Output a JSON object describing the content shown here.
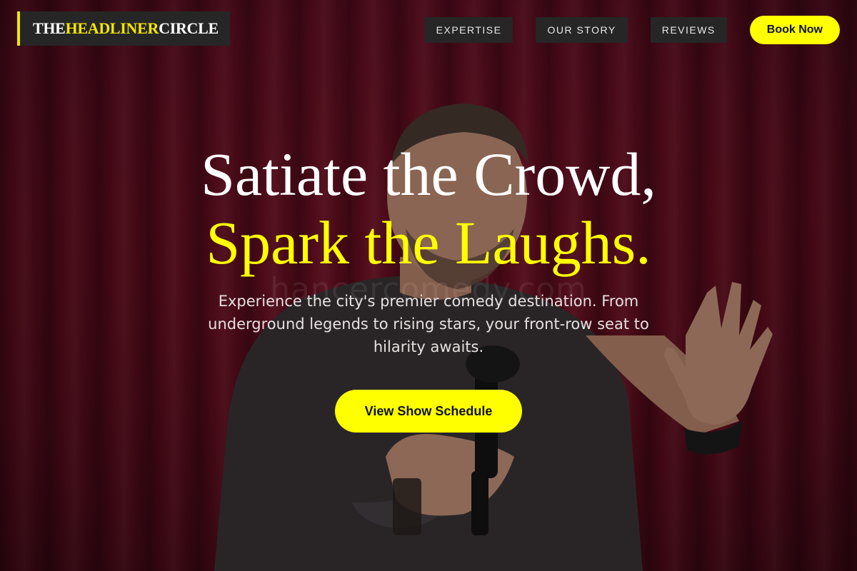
{
  "brand": {
    "part1": "THE ",
    "accent": "HEADLINER",
    "part2": " CIRCLE"
  },
  "nav": {
    "items": [
      {
        "label": "EXPERTISE"
      },
      {
        "label": "OUR STORY"
      },
      {
        "label": "REVIEWS"
      }
    ],
    "book_label": "Book Now"
  },
  "hero": {
    "line1": "Satiate the Crowd,",
    "line2": "Spark the Laughs.",
    "subtitle": "Experience the city's premier comedy destination. From underground legends to rising stars, your front-row seat to hilarity awaits.",
    "cta_label": "View Show Schedule",
    "watermark": "hancercomedy.com"
  },
  "colors": {
    "accent": "#ffff00",
    "curtain": "#7d1228",
    "nav_bg": "#262626"
  }
}
